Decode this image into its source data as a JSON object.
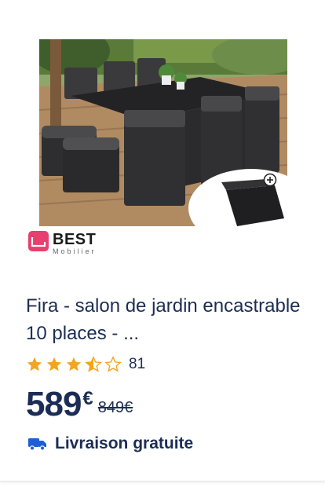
{
  "product": {
    "title": "Fira - salon de jardin encastrable 10 places - ...",
    "image_alt": "Salon de jardin encastrable en résine tressée noire avec housse",
    "rating": {
      "stars": 3.5,
      "max": 5,
      "count": "81"
    },
    "price": {
      "current": "589",
      "currency": "€",
      "old": "849€"
    },
    "delivery": "Livraison gratuite"
  },
  "brand": {
    "name": "BEST",
    "subtitle": "Mobilier",
    "color": "#e73f6f"
  },
  "colors": {
    "text": "#1c2d55",
    "star": "#f4a41e"
  },
  "icons": {
    "cover_badge": "plus-circle-icon",
    "delivery": "truck-icon"
  }
}
